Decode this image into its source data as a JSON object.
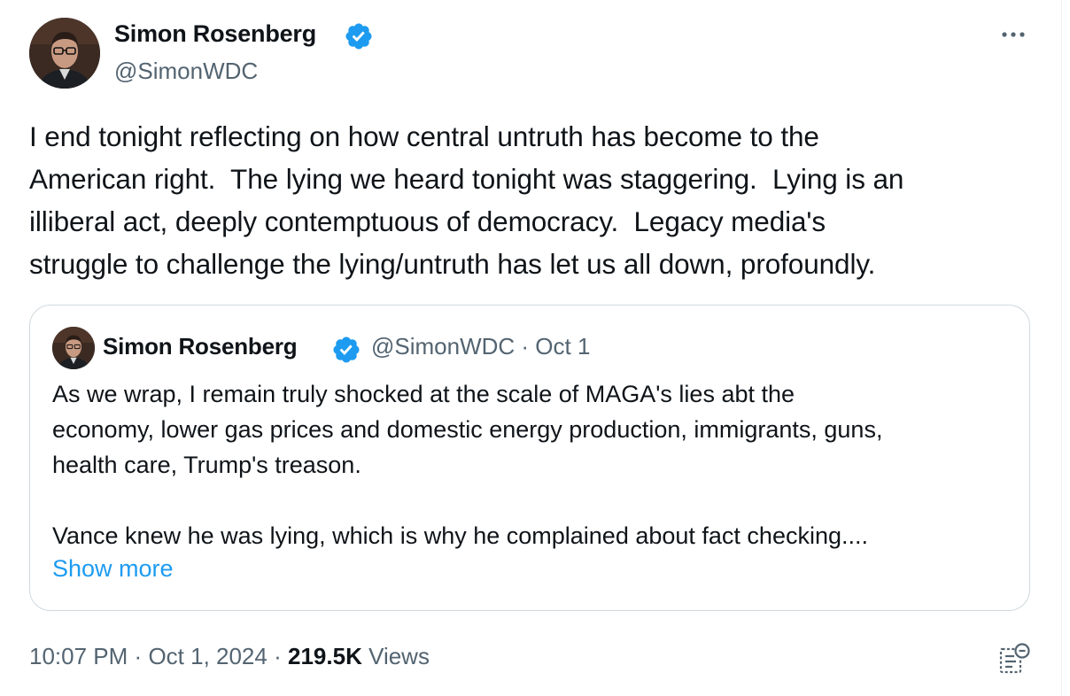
{
  "tweet": {
    "author": {
      "name": "Simon Rosenberg",
      "handle": "@SimonWDC",
      "verified": true
    },
    "text": "I end tonight reflecting on how central untruth has become to the\nAmerican right.  The lying we heard tonight was staggering.  Lying is an\nilliberal act, deeply contemptuous of democracy.  Legacy media's\nstruggle to challenge the lying/untruth has let us all down, profoundly.",
    "quoted_tweet": {
      "author_name": "Simon Rosenberg",
      "meta": "@SimonWDC · Oct 1",
      "text": "As we wrap, I remain truly shocked at the scale of MAGA's lies abt the\neconomy, lower gas prices and domestic energy production, immigrants, guns,\nhealth care, Trump's treason.\n\nVance knew he was lying, which is why he complained about fact checking....",
      "show_more_label": "Show more"
    },
    "footer": {
      "time": "10:07 PM",
      "date": "Oct 1, 2024",
      "separator": "·",
      "views_count": "219.5K",
      "views_label": "Views"
    }
  },
  "icons": {
    "more": "more-horizontal-icon",
    "verified": "verified-badge-icon",
    "grok": "grok-explain-icon"
  },
  "colors": {
    "text_primary": "#0f1419",
    "text_secondary": "#536471",
    "accent": "#1d9bf0",
    "border": "#cfd9de"
  }
}
